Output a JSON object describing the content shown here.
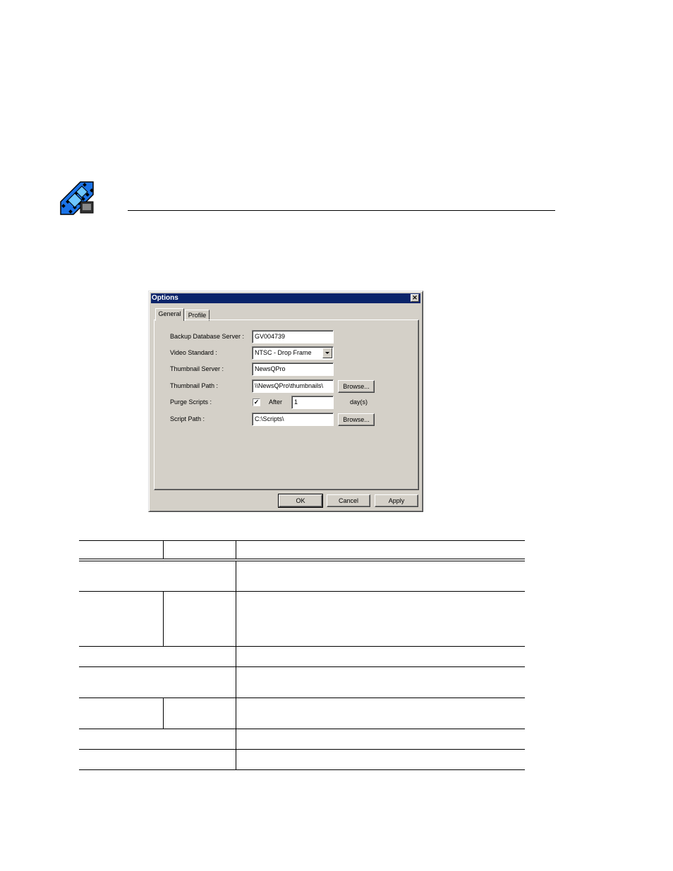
{
  "dialog": {
    "title": "Options",
    "close_glyph": "✕",
    "tabs": [
      {
        "label": "General"
      },
      {
        "label": "Profile"
      }
    ],
    "fields": {
      "backup_db_server": {
        "label": "Backup Database Server :",
        "value": "GV004739"
      },
      "video_standard": {
        "label": "Video Standard :",
        "value": "NTSC - Drop Frame"
      },
      "thumbnail_server": {
        "label": "Thumbnail Server :",
        "value": "NewsQPro"
      },
      "thumbnail_path": {
        "label": "Thumbnail Path :",
        "value": "\\\\NewsQPro\\thumbnails\\"
      },
      "purge_scripts": {
        "label": "Purge Scripts :",
        "checked": true,
        "check_glyph": "✓",
        "after_label": "After",
        "days_value": "1",
        "days_unit": "day(s)"
      },
      "script_path": {
        "label": "Script Path :",
        "value": "C:\\Scripts\\"
      }
    },
    "buttons": {
      "browse_label": "Browse...",
      "ok_label": "OK",
      "cancel_label": "Cancel",
      "apply_label": "Apply"
    }
  },
  "icons": {
    "logo": "film-strip-icon",
    "dropdown": "chevron-down-icon",
    "close": "close-icon"
  },
  "colors": {
    "titlebar": "#0a246a",
    "dialog_face": "#d4d0c8",
    "logo_blue": "#1a73e8"
  }
}
